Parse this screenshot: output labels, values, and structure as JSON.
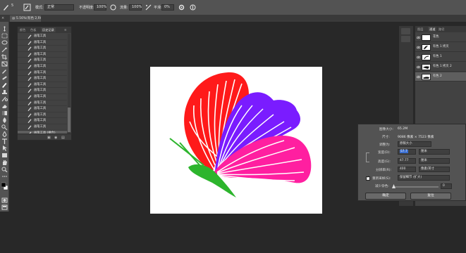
{
  "options_bar": {
    "mode_label": "模式:",
    "mode_value": "正常",
    "opacity_label": "不透明度:",
    "opacity_value": "100%",
    "flow_label": "流量:",
    "flow_value": "100%",
    "smooth_label": "平滑:",
    "smooth_value": "0%",
    "brush_size": "5"
  },
  "document_tab": {
    "title": "@ 5.56%(有色 2,RGB/8)",
    "close": "×"
  },
  "history_panel": {
    "tabs": [
      "历史记录",
      "图层",
      "历史记录"
    ],
    "tab_labels": {
      "t1": "颜色",
      "t2": "色板",
      "t3": "历史记录"
    },
    "items": [
      "画笔工具",
      "画笔工具",
      "画笔工具",
      "画笔工具",
      "画笔工具",
      "画笔工具",
      "画笔工具",
      "画笔工具",
      "画笔工具",
      "画笔工具",
      "画笔工具",
      "画笔工具",
      "画笔工具",
      "画笔工具",
      "画笔工具",
      "画笔工具",
      "画笔工具 (拼合)"
    ]
  },
  "layers_panel": {
    "tab_labels": {
      "t1": "图层",
      "t2": "通道",
      "t3": "路径"
    },
    "layers": [
      {
        "name": "花色"
      },
      {
        "name": "有色 1 拷贝"
      },
      {
        "name": "有色 1"
      },
      {
        "name": "有色 1 拷贝 2"
      },
      {
        "name": "有色 2"
      }
    ]
  },
  "image_size_dialog": {
    "image_size_label": "图像大小:",
    "image_size_value": "65.2M",
    "dimensions_label": "尺寸:",
    "dimensions_value": "9086 像素 × 7523 像素",
    "fit_to_label": "调整为:",
    "fit_to_value": "原稿大小",
    "width_label": "宽度(D):",
    "width_value": "57.7",
    "width_unit": "厘米",
    "height_label": "高度(G):",
    "height_value": "47.77",
    "height_unit": "厘米",
    "resolution_label": "分辨率(R):",
    "resolution_value": "400",
    "resolution_unit": "像素/英寸",
    "resample_label": "重新采样(S):",
    "resample_value": "保留细节 (扩大)",
    "reduce_noise_label": "减少杂色:",
    "reduce_noise_value": "0",
    "ok_label": "确定",
    "cancel_label": "复位"
  },
  "colors": {
    "red": "#ff1a1a",
    "purple": "#7a1cff",
    "pink": "#ff1fa0",
    "green": "#2db52d"
  }
}
